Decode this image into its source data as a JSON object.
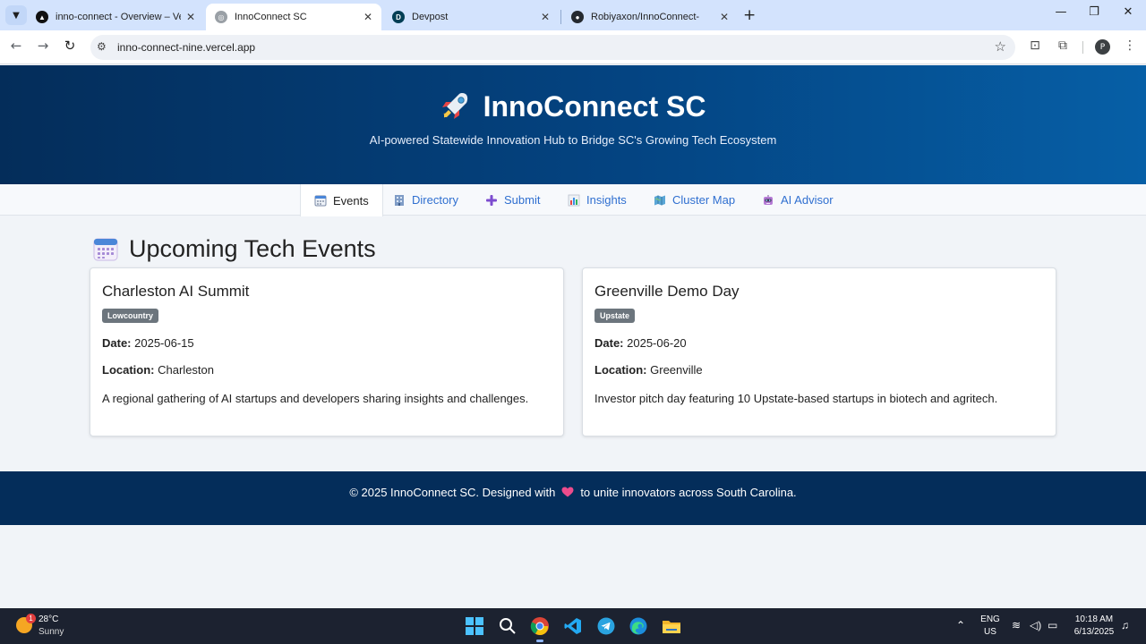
{
  "browser": {
    "tabs": [
      {
        "title": "inno-connect - Overview – Verc",
        "active": false
      },
      {
        "title": "InnoConnect SC",
        "active": true
      },
      {
        "title": "Devpost",
        "active": false
      },
      {
        "title": "Robiyaxon/InnoConnect-",
        "active": false
      }
    ],
    "url": "inno-connect-nine.vercel.app",
    "profile_initial": "P",
    "devpost_letter": "D"
  },
  "hero": {
    "title": "InnoConnect SC",
    "subtitle": "AI-powered Statewide Innovation Hub to Bridge SC's Growing Tech Ecosystem"
  },
  "nav": {
    "items": [
      {
        "label": "Events",
        "icon": "calendar-icon",
        "active": true
      },
      {
        "label": "Directory",
        "icon": "building-icon",
        "active": false
      },
      {
        "label": "Submit",
        "icon": "plus-icon",
        "active": false
      },
      {
        "label": "Insights",
        "icon": "bar-chart-icon",
        "active": false
      },
      {
        "label": "Cluster Map",
        "icon": "map-icon",
        "active": false
      },
      {
        "label": "AI Advisor",
        "icon": "robot-icon",
        "active": false
      }
    ]
  },
  "main": {
    "section_title": "Upcoming Tech Events",
    "date_label": "Date:",
    "location_label": "Location:",
    "events": [
      {
        "title": "Charleston AI Summit",
        "region": "Lowcountry",
        "date": "2025-06-15",
        "location": "Charleston",
        "description": "A regional gathering of AI startups and developers sharing insights and challenges."
      },
      {
        "title": "Greenville Demo Day",
        "region": "Upstate",
        "date": "2025-06-20",
        "location": "Greenville",
        "description": "Investor pitch day featuring 10 Upstate-based startups in biotech and agritech."
      }
    ]
  },
  "footer": {
    "before": "© 2025 InnoConnect SC. Designed with",
    "after": "to unite innovators across South Carolina."
  },
  "taskbar": {
    "weather_temp": "28°C",
    "weather_cond": "Sunny",
    "weather_badge": "1",
    "lang_top": "ENG",
    "lang_bottom": "US",
    "time": "10:18 AM",
    "date": "6/13/2025"
  },
  "colors": {
    "hero_dark": "#042d5a",
    "hero_light": "#065fa6",
    "link_blue": "#2f6fd0",
    "badge_gray": "#6c757d"
  }
}
